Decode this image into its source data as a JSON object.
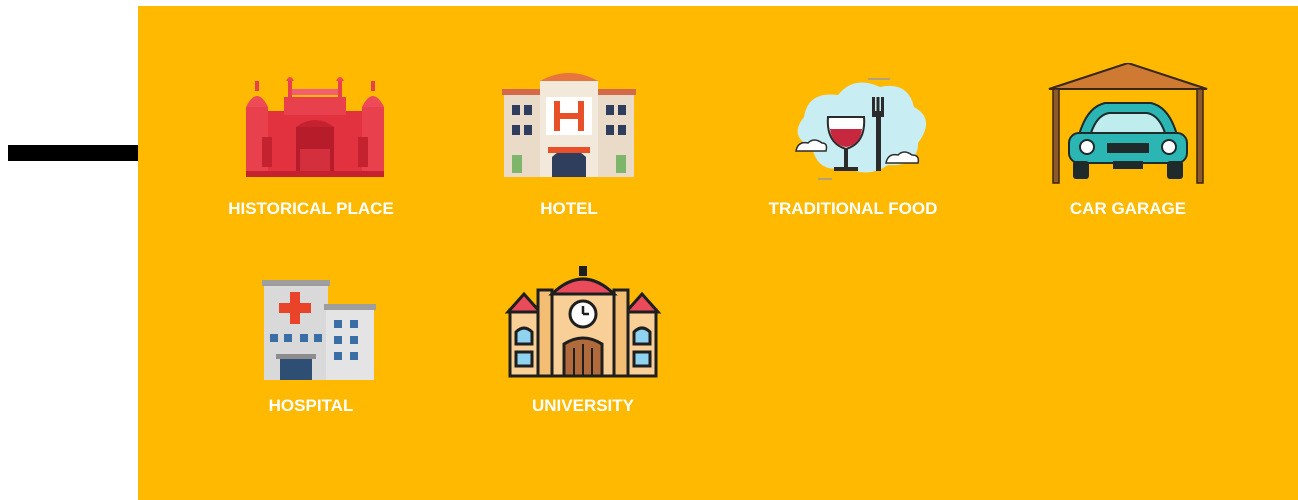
{
  "background_color": "#FFB900",
  "arrow_color": "#000000",
  "categories": [
    {
      "label": "HISTORICAL PLACE",
      "icon": "red-fort-icon"
    },
    {
      "label": "HOTEL",
      "icon": "hotel-icon"
    },
    {
      "label": "TRADITIONAL FOOD",
      "icon": "wine-glass-fork-icon"
    },
    {
      "label": "CAR GARAGE",
      "icon": "car-garage-icon"
    },
    {
      "label": "HOSPITAL",
      "icon": "hospital-icon"
    },
    {
      "label": "UNIVERSITY",
      "icon": "university-icon"
    }
  ]
}
